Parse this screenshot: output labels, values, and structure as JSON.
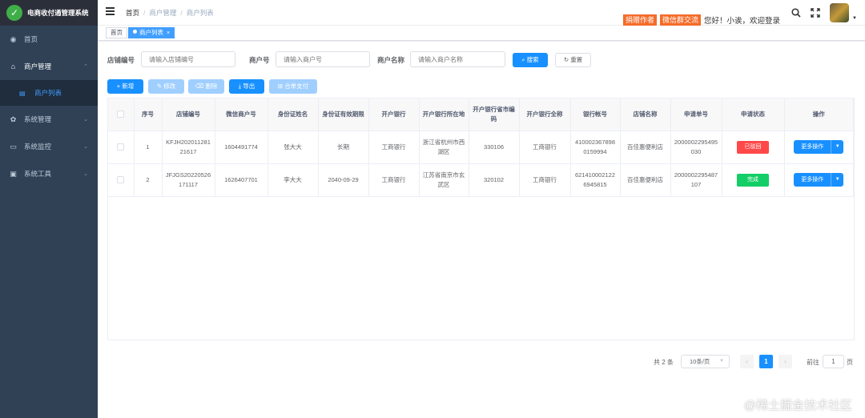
{
  "app": {
    "title": "电商收付通管理系统"
  },
  "sidebar": {
    "items": [
      {
        "label": "首页",
        "icon": "dashboard-icon"
      },
      {
        "label": "商户管理",
        "icon": "shop-icon"
      },
      {
        "label": "商户列表",
        "icon": "list-icon"
      },
      {
        "label": "系统管理",
        "icon": "gear-icon"
      },
      {
        "label": "系统监控",
        "icon": "monitor-icon"
      },
      {
        "label": "系统工具",
        "icon": "tool-icon"
      }
    ]
  },
  "header": {
    "breadcrumb": [
      "首页",
      "商户管理",
      "商户列表"
    ],
    "tags": [
      "捐赠作者",
      "微信群交流"
    ],
    "welcome": "您好！小诶，欢迎登录"
  },
  "tags_view": {
    "tabs": [
      "首页",
      "商户列表"
    ]
  },
  "search": {
    "shop_no_label": "店铺编号",
    "shop_no_placeholder": "请输入店铺编号",
    "merchant_no_label": "商户号",
    "merchant_no_placeholder": "请输入商户号",
    "merchant_name_label": "商户名称",
    "merchant_name_placeholder": "请输入商户名称",
    "search_button": "搜索",
    "reset_button": "重置"
  },
  "toolbar": {
    "add": "新增",
    "edit": "修改",
    "delete": "删除",
    "export": "导出",
    "combined_pay": "合单支付"
  },
  "table": {
    "columns": [
      "序号",
      "店铺编号",
      "微信商户号",
      "身份证姓名",
      "身份证有效期限",
      "开户银行",
      "开户银行所在地",
      "开户银行省市编码",
      "开户银行全称",
      "银行帐号",
      "店铺名称",
      "申请单号",
      "申请状态",
      "操作"
    ],
    "rows": [
      {
        "index": "1",
        "shop_no": "KFJH20201128121617",
        "wx_merchant_no": "1604491774",
        "id_name": "张大大",
        "id_expiry": "长期",
        "bank": "工商银行",
        "bank_location": "浙江省杭州市西湖区",
        "bank_code": "330106",
        "bank_full_name": "工商银行",
        "account_no": "4100023678980159994",
        "shop_name": "百佳惠便利店",
        "apply_no": "2000002295495030",
        "status": "已驳回",
        "status_color": "#ff4949",
        "action": "更多操作"
      },
      {
        "index": "2",
        "shop_no": "JFJGS20220526171117",
        "wx_merchant_no": "1626407701",
        "id_name": "李大大",
        "id_expiry": "2040-09-29",
        "bank": "工商银行",
        "bank_location": "江苏省南京市玄武区",
        "bank_code": "320102",
        "bank_full_name": "工商银行",
        "account_no": "6214100021226945815",
        "shop_name": "百佳惠便利店",
        "apply_no": "2000002295487107",
        "status": "完成",
        "status_color": "#13ce66",
        "action": "更多操作"
      }
    ]
  },
  "pagination": {
    "total": "共 2 条",
    "page_size": "10条/页",
    "current_page": "1",
    "goto_label": "前往",
    "goto_value": "1",
    "page_unit": "页"
  },
  "watermark": "@稀土掘金技术社区",
  "colors": {
    "primary": "#1890ff",
    "sidebar": "#304156",
    "danger": "#ff4949",
    "success": "#13ce66",
    "accent_tag": "#f56c2a"
  }
}
